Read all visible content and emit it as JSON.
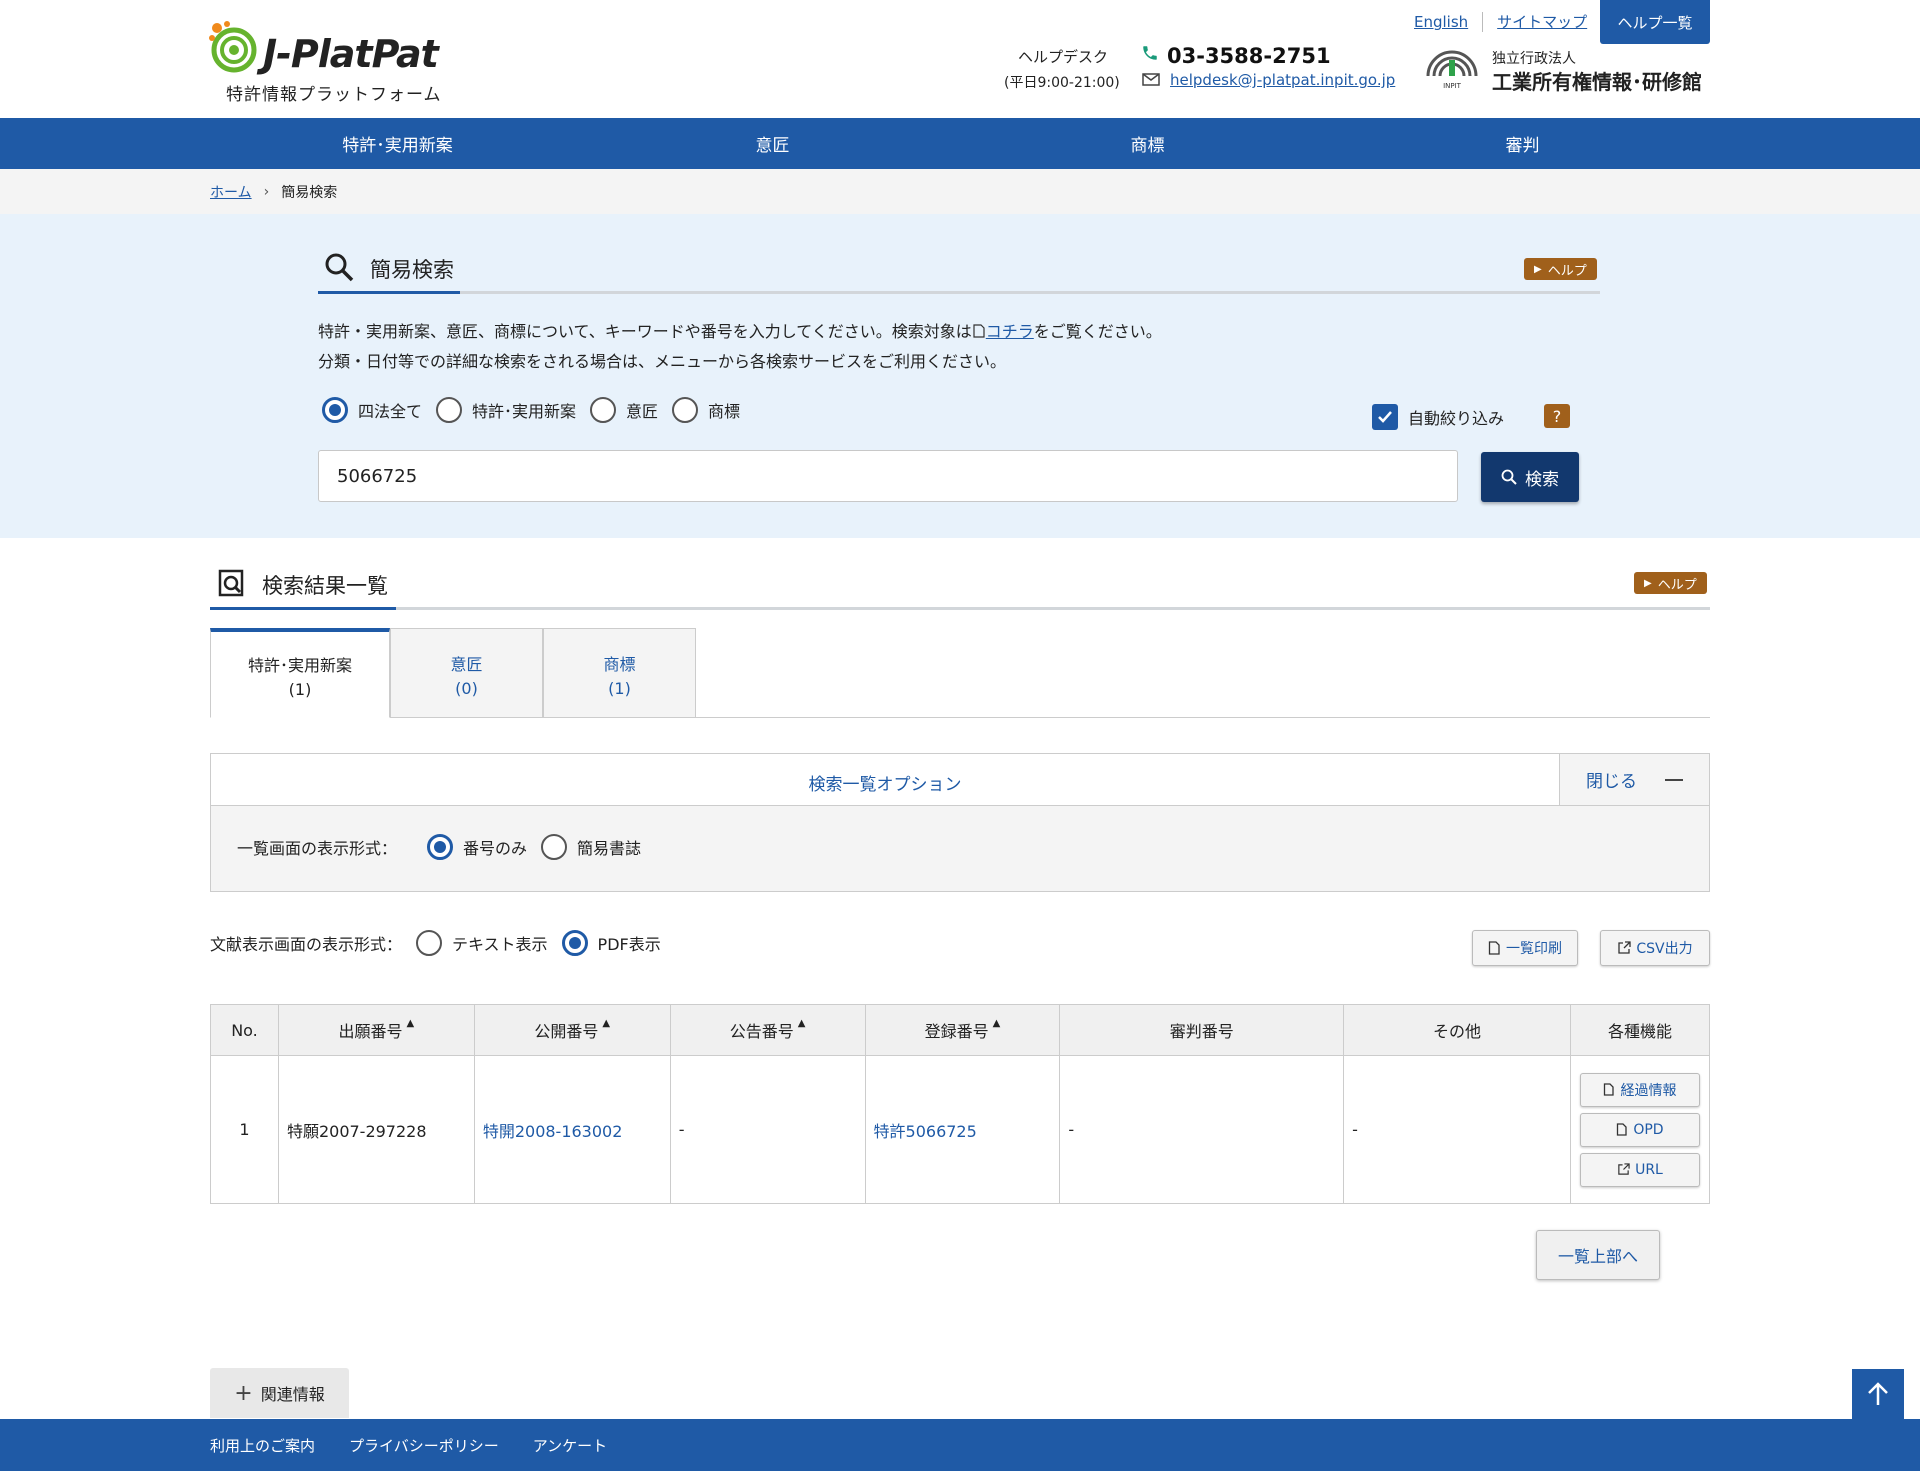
{
  "header": {
    "logo_text": "J-PlatPat",
    "logo_sub": "特許情報プラットフォーム",
    "helpdesk_label": "ヘルプデスク",
    "helpdesk_hours": "(平日9:00-21:00)",
    "phone": "03-3588-2751",
    "email": "helpdesk@j-platpat.inpit.go.jp",
    "links": [
      "English",
      "サイトマップ"
    ],
    "help_list": "ヘルプ一覧",
    "inpit_small": "独立行政法人",
    "inpit_name": "工業所有権情報･研修館",
    "inpit_logo_text": "INPIT"
  },
  "nav": [
    "特許･実用新案",
    "意匠",
    "商標",
    "審判"
  ],
  "breadcrumb": {
    "home": "ホーム",
    "current": "簡易検索"
  },
  "search": {
    "title": "簡易検索",
    "help": "ヘルプ",
    "desc1_pre": "特許・実用新案、意匠、商標について、キーワードや番号を入力してください。検索対象は",
    "desc1_link": "コチラ",
    "desc1_post": "をご覧ください。",
    "desc2": "分類・日付等での詳細な検索をされる場合は、メニューから各検索サービスをご利用ください。",
    "radios": [
      "四法全て",
      "特許･実用新案",
      "意匠",
      "商標"
    ],
    "radio_selected": 0,
    "auto_filter_label": "自動絞り込み",
    "auto_filter_checked": true,
    "qmark": "?",
    "input_value": "5066725",
    "button": "検索"
  },
  "results": {
    "title": "検索結果一覧",
    "help": "ヘルプ",
    "tabs": [
      {
        "label": "特許･実用新案",
        "count": "(1)"
      },
      {
        "label": "意匠",
        "count": "(0)"
      },
      {
        "label": "商標",
        "count": "(1)"
      }
    ],
    "options_title": "検索一覧オプション",
    "close_label": "閉じる",
    "list_format_label": "一覧画面の表示形式：",
    "list_format_options": [
      "番号のみ",
      "簡易書誌"
    ],
    "doc_format_label": "文献表示画面の表示形式：",
    "doc_format_options": [
      "テキスト表示",
      "PDF表示"
    ],
    "print_btn": "一覧印刷",
    "csv_btn": "CSV出力",
    "columns": [
      "No.",
      "出願番号",
      "公開番号",
      "公告番号",
      "登録番号",
      "審判番号",
      "その他",
      "各種機能"
    ],
    "rows": [
      {
        "no": "1",
        "app_no": "特願2007-297228",
        "pub_no": "特開2008-163002",
        "announce_no": "-",
        "reg_no": "特許5066725",
        "trial_no": "-",
        "other": "-"
      }
    ],
    "fn_buttons": [
      "経過情報",
      "OPD",
      "URL"
    ],
    "to_top": "一覧上部へ"
  },
  "related": "関連情報",
  "footer": [
    "利用上のご案内",
    "プライバシーポリシー",
    "アンケート"
  ],
  "colors": {
    "primary": "#1f5aa6",
    "dark": "#12386e",
    "accent": "#a0601b",
    "search_bg": "#e8f2fb"
  }
}
